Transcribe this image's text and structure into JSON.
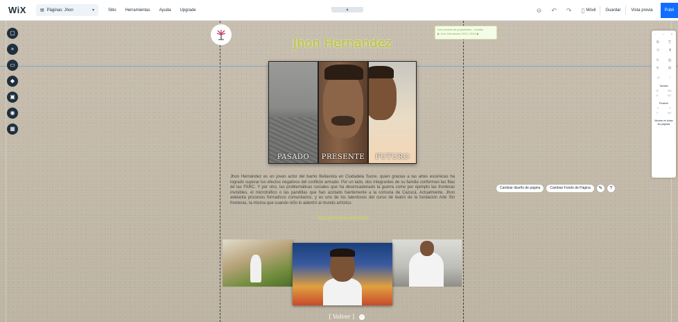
{
  "topbar": {
    "logo": "WiX",
    "page_selector": "Páginas: Jhon",
    "menu": [
      "Sitio",
      "Herramientas",
      "Ayuda",
      "Upgrade"
    ],
    "mobile": "Móvil",
    "save": "Guardar",
    "preview": "Vista previa",
    "publish": "Publi"
  },
  "handle": "▴",
  "site": {
    "title": "Jhon Hernández",
    "notice_line1": "Las cuentas de propietarios , Cambio",
    "notice_line2": "▶ Jhon Hernández 2020 | 2019 ▶",
    "panels": [
      "PASADO",
      "PRESENTE",
      "FUTURO"
    ],
    "bio": "Jhon Hernández es un joven actor del barrio Bellavista en Ciudadela Sucre, quien gracias a las artes escénicas ha logrado superar los efectos negativos del conflicto armado. Por un lado, dos integrantes de su familia conforman las filas de las FARC. Y por otro, las problemáticas sociales que ha desencadenado la guerra como por ejemplo las fronteras invisibles, el microtráfico o las pandillas que han azotado fuertemente a la comuna de Cazucá. Actualmente, Jhon adelanta procesos formativos comunitarios, y es uno de los talentosos del curso de teatro de la fundación Arte Sin fronteras, la misma que cuando niño lo adentró al mundo artístico.",
    "bio_link": "Soy cybervideo salsa video",
    "back": "[ Volver ]"
  },
  "page_buttons": {
    "change_design": "Cambiar diseño de página",
    "change_bg": "Cambiar Fondo de Página"
  },
  "inspector": {
    "size": "Tamaño",
    "w_label": "W",
    "w_val": "490",
    "h_label": "H",
    "h_val": "307",
    "position": "Posición",
    "x_label": "X",
    "x_val": "0",
    "y_label": "Y",
    "y_val": "190",
    "show_all": "Mostrar en todas las páginas"
  },
  "colors": {
    "accent": "#116dff",
    "title": "#b8c24a",
    "dark": "#20303c"
  }
}
